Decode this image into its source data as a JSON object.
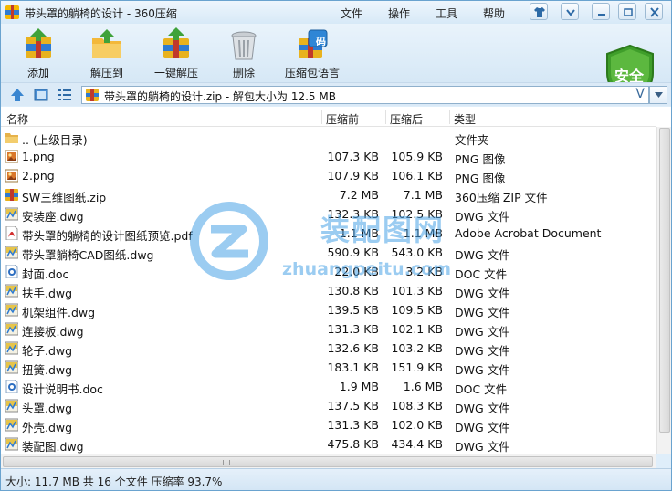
{
  "window": {
    "title": "带头罩的躺椅的设计 - 360压缩",
    "menu": [
      "文件",
      "操作",
      "工具",
      "帮助"
    ]
  },
  "toolbar": {
    "buttons": [
      "添加",
      "解压到",
      "一键解压",
      "删除",
      "压缩包语言"
    ],
    "shield_label": "安全",
    "code_badge": "码"
  },
  "address": {
    "text": "带头罩的躺椅的设计.zip - 解包大小为 12.5 MB",
    "v_label": "V"
  },
  "columns": {
    "name": "名称",
    "compressed": "压缩前",
    "original": "压缩后",
    "type": "类型"
  },
  "files": [
    {
      "icon": "folder-icon",
      "name": ".. (上级目录)",
      "compressed": "",
      "original": "",
      "type": "文件夹"
    },
    {
      "icon": "png-icon",
      "name": "1.png",
      "compressed": "107.3 KB",
      "original": "105.9 KB",
      "type": "PNG 图像"
    },
    {
      "icon": "png-icon",
      "name": "2.png",
      "compressed": "107.9 KB",
      "original": "106.1 KB",
      "type": "PNG 图像"
    },
    {
      "icon": "zip-icon",
      "name": "SW三维图纸.zip",
      "compressed": "7.2 MB",
      "original": "7.1 MB",
      "type": "360压缩 ZIP 文件"
    },
    {
      "icon": "dwg-icon",
      "name": "安装座.dwg",
      "compressed": "132.3 KB",
      "original": "102.5 KB",
      "type": "DWG 文件"
    },
    {
      "icon": "pdf-icon",
      "name": "带头罩的躺椅的设计图纸预览.pdf",
      "compressed": "1.1 MB",
      "original": "1.1 MB",
      "type": "Adobe Acrobat Document"
    },
    {
      "icon": "dwg-icon",
      "name": "带头罩躺椅CAD图纸.dwg",
      "compressed": "590.9 KB",
      "original": "543.0 KB",
      "type": "DWG 文件"
    },
    {
      "icon": "doc-icon",
      "name": "封面.doc",
      "compressed": "22.0 KB",
      "original": "3.2 KB",
      "type": "DOC 文件"
    },
    {
      "icon": "dwg-icon",
      "name": "扶手.dwg",
      "compressed": "130.8 KB",
      "original": "101.3 KB",
      "type": "DWG 文件"
    },
    {
      "icon": "dwg-icon",
      "name": "机架组件.dwg",
      "compressed": "139.5 KB",
      "original": "109.5 KB",
      "type": "DWG 文件"
    },
    {
      "icon": "dwg-icon",
      "name": "连接板.dwg",
      "compressed": "131.3 KB",
      "original": "102.1 KB",
      "type": "DWG 文件"
    },
    {
      "icon": "dwg-icon",
      "name": "轮子.dwg",
      "compressed": "132.6 KB",
      "original": "103.2 KB",
      "type": "DWG 文件"
    },
    {
      "icon": "dwg-icon",
      "name": "扭簧.dwg",
      "compressed": "183.1 KB",
      "original": "151.9 KB",
      "type": "DWG 文件"
    },
    {
      "icon": "doc-icon",
      "name": "设计说明书.doc",
      "compressed": "1.9 MB",
      "original": "1.6 MB",
      "type": "DOC 文件"
    },
    {
      "icon": "dwg-icon",
      "name": "头罩.dwg",
      "compressed": "137.5 KB",
      "original": "108.3 KB",
      "type": "DWG 文件"
    },
    {
      "icon": "dwg-icon",
      "name": "外壳.dwg",
      "compressed": "131.3 KB",
      "original": "102.0 KB",
      "type": "DWG 文件"
    },
    {
      "icon": "dwg-icon",
      "name": "装配图.dwg",
      "compressed": "475.8 KB",
      "original": "434.4 KB",
      "type": "DWG 文件"
    }
  ],
  "status": {
    "text": "大小: 11.7 MB 共 16 个文件 压缩率 93.7%"
  },
  "watermark": {
    "cn": "装配图网",
    "en": "zhuangpeitu.com"
  },
  "colors": {
    "accent": "#2a6fb0",
    "shield": "#3f9e2a",
    "watermark": "#4aa3e6"
  }
}
